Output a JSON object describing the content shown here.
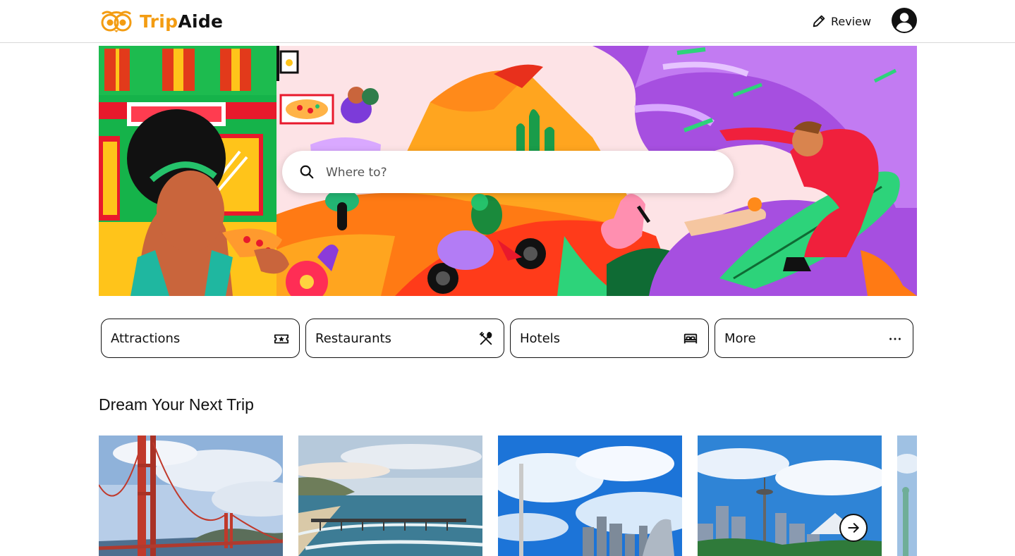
{
  "header": {
    "logo_text_1": "Trip",
    "logo_text_2": "Aide",
    "review_label": "Review",
    "logo_color": "#f39c12"
  },
  "search": {
    "placeholder": "Where to?"
  },
  "categories": [
    {
      "label": "Attractions",
      "icon": "ticket-icon"
    },
    {
      "label": "Restaurants",
      "icon": "utensils-icon"
    },
    {
      "label": "Hotels",
      "icon": "bed-icon"
    },
    {
      "label": "More",
      "icon": "more-dots-icon"
    }
  ],
  "section": {
    "title": "Dream Your Next Trip"
  },
  "destinations": [
    {
      "scene": "golden-gate-bridge"
    },
    {
      "scene": "ocean-pier"
    },
    {
      "scene": "city-skyline-clouds"
    },
    {
      "scene": "space-needle-skyline"
    },
    {
      "scene": "statue-of-liberty"
    }
  ],
  "carousel": {
    "next_icon": "arrow-right-icon"
  }
}
